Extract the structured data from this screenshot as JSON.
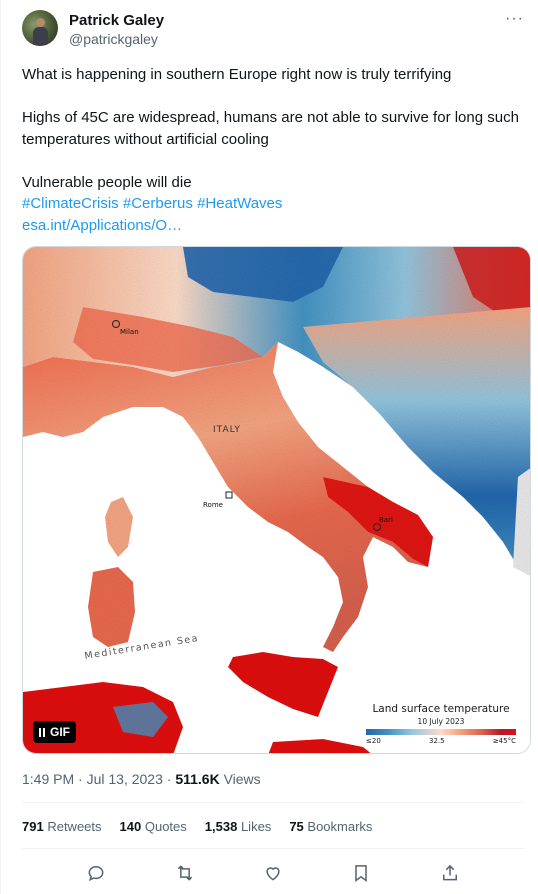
{
  "author": {
    "name": "Patrick Galey",
    "handle": "@patrickgaley"
  },
  "more_label": "···",
  "tweet": {
    "lines": [
      "What is happening in southern Europe right now is truly terrifying",
      "Highs of 45C are widespread, humans are not able to survive for long such temperatures without artificial cooling",
      "Vulnerable people will die"
    ],
    "hashtags": [
      "#ClimateCrisis",
      "#Cerberus",
      "#HeatWaves"
    ],
    "link": "esa.int/Applications/O…"
  },
  "media": {
    "map_labels": {
      "milan": "Milan",
      "italy": "ITALY",
      "rome": "Rome",
      "bari": "Bari",
      "sea": "Mediterranean Sea"
    },
    "legend": {
      "title": "Land surface temperature",
      "date": "10 July 2023",
      "min": "≤20",
      "mid": "32.5",
      "max": "≥45°C"
    },
    "gif_label": "GIF",
    "colors": {
      "hot": "#e01010",
      "warm": "#f4a582",
      "cool": "#4393c3",
      "cold": "#2166ac",
      "sea": "#ffffff"
    }
  },
  "meta": {
    "time": "1:49 PM · Jul 13, 2023 · ",
    "views_count": "511.6K",
    "views_label": " Views"
  },
  "stats": {
    "retweets_count": "791",
    "retweets_label": "Retweets",
    "quotes_count": "140",
    "quotes_label": "Quotes",
    "likes_count": "1,538",
    "likes_label": "Likes",
    "bookmarks_count": "75",
    "bookmarks_label": "Bookmarks"
  },
  "actions": [
    "reply-icon",
    "retweet-icon",
    "like-icon",
    "bookmark-icon",
    "share-icon"
  ]
}
